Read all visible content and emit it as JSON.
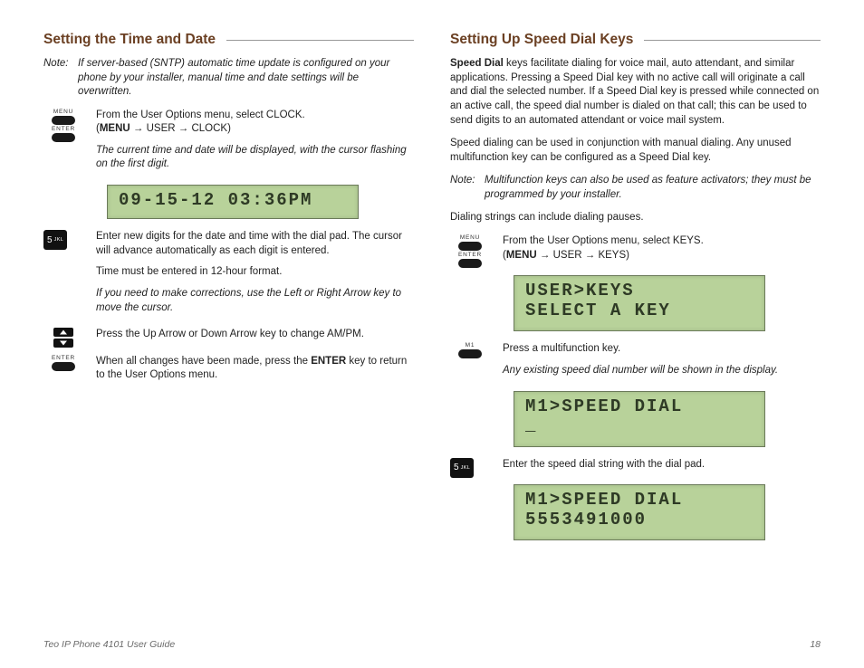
{
  "left": {
    "heading": "Setting the Time and Date",
    "note_label": "Note:",
    "note_body": "If server-based (SNTP) automatic time update is configured on your phone by your installer, manual time and date settings will be overwritten.",
    "menu_label": "MENU",
    "enter_label": "ENTER",
    "step1_line1_pre": "From the User Options menu, select CLOCK.",
    "step1_line2_open": "(",
    "step1_line2_menu": "MENU",
    "step1_line2_rest": " → USER → CLOCK)",
    "step1_italic": "The current time and date will be displayed, with the cursor flashing on the first digit.",
    "lcd1": "09-15-12 03:36PM",
    "key5_main": "5",
    "key5_sub": "JKL",
    "step2_p1": "Enter new digits for the date and time with the dial pad. The cursor will advance automatically as each digit is entered.",
    "step2_p2": "Time must be entered in 12-hour format.",
    "step2_italic": "If you need to make corrections, use the Left or Right Arrow key to move the cursor.",
    "step3": "Press the Up Arrow or Down Arrow key to change AM/PM.",
    "step4_pre": "When all changes have been made, press the ",
    "step4_bold": "ENTER",
    "step4_post": " key to return to the User Options menu."
  },
  "right": {
    "heading": "Setting Up Speed Dial Keys",
    "p1_bold": "Speed Dial",
    "p1_rest": " keys facilitate dialing for voice mail, auto attendant, and similar applications. Pressing a Speed Dial key with no active call will originate a call and dial the selected number. If a Speed Dial key is pressed while connected on an active call, the speed dial number is dialed on that call; this can be used to send digits to an automated attendant or voice mail system.",
    "p2": "Speed dialing can be used in conjunction with manual dialing. Any unused multifunction key can be configured as a Speed Dial key.",
    "note_label": "Note:",
    "note_body": "Multifunction keys can also be used as feature activators; they must be programmed by your installer.",
    "p3": "Dialing strings can include dialing pauses.",
    "menu_label": "MENU",
    "enter_label": "ENTER",
    "step1_line1": "From the User Options menu, select KEYS.",
    "step1_line2_open": "(",
    "step1_line2_menu": "MENU",
    "step1_line2_rest": " → USER → KEYS)",
    "lcd1": "USER>KEYS\nSELECT A KEY",
    "m1_label": "M1",
    "step2_p1": "Press a multifunction key.",
    "step2_italic": "Any existing speed dial number will be shown in the display.",
    "lcd2": "M1>SPEED DIAL\n_",
    "key5_main": "5",
    "key5_sub": "JKL",
    "step3": "Enter the speed dial string with the dial pad.",
    "lcd3": "M1>SPEED DIAL\n5553491000"
  },
  "footer": {
    "left": "Teo IP Phone 4101 User Guide",
    "right": "18"
  }
}
